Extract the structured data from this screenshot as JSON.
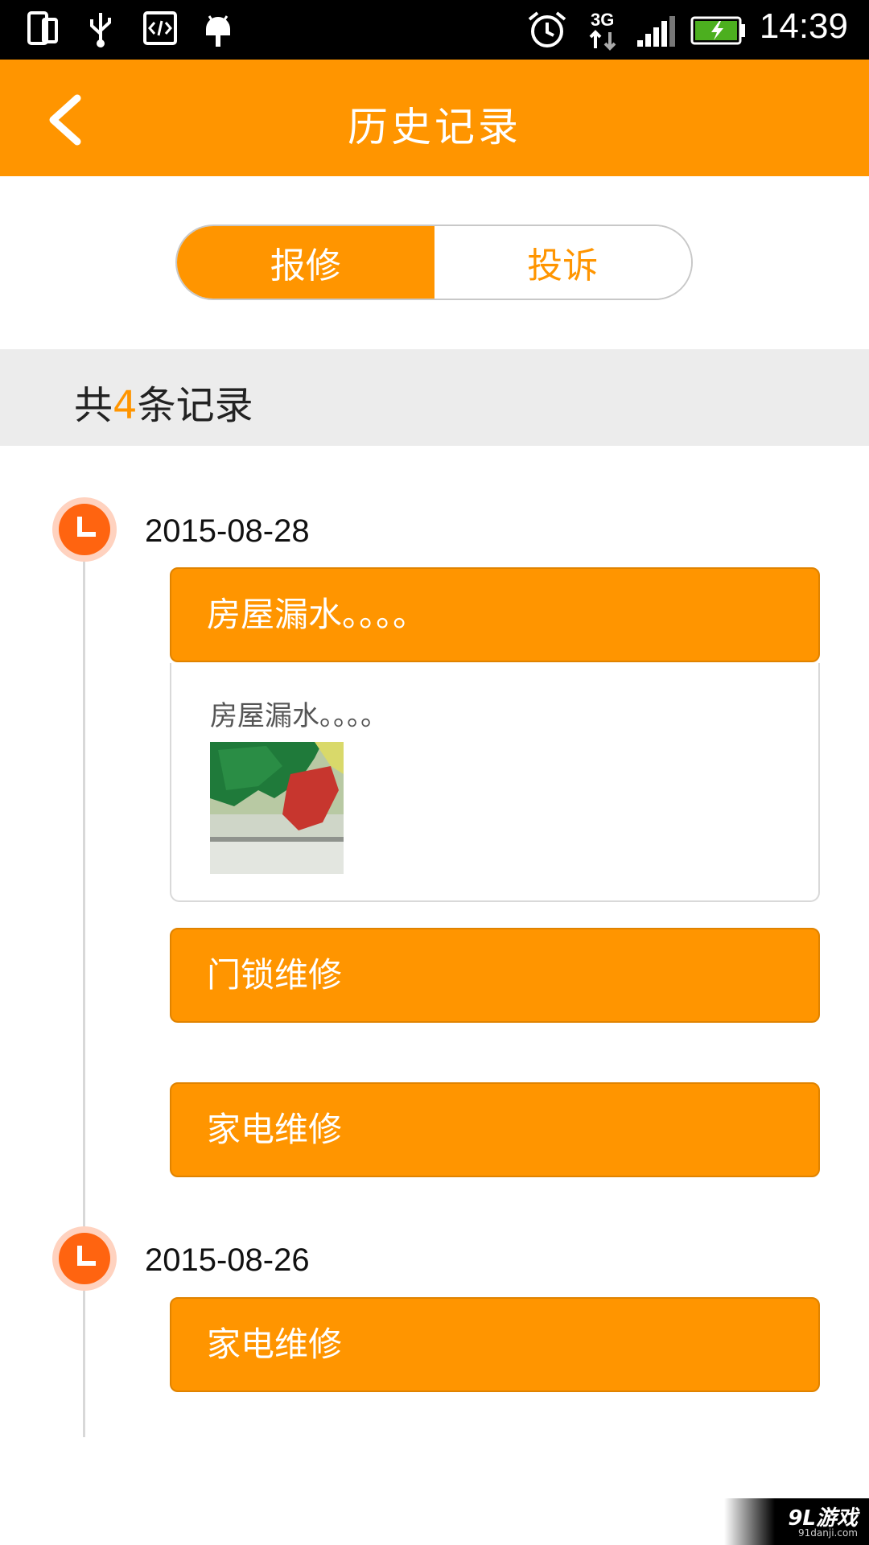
{
  "status_bar": {
    "time": "14:39",
    "network": "3G",
    "icons": [
      "phone-screens-icon",
      "usb-icon",
      "code-icon",
      "android-icon",
      "alarm-icon",
      "network-3g-icon",
      "signal-icon",
      "battery-charging-icon"
    ]
  },
  "header": {
    "title": "历史记录",
    "back_icon": "chevron-left-icon",
    "background": "#ff9500"
  },
  "tabs": [
    {
      "label": "报修",
      "active": true
    },
    {
      "label": "投诉",
      "active": false
    }
  ],
  "summary": {
    "prefix": "共",
    "count": "4",
    "suffix": "条记录"
  },
  "timeline": [
    {
      "date": "2015-08-28",
      "items": [
        {
          "title": "房屋漏水。。。。",
          "expanded": true,
          "detail": "房屋漏水。。。。",
          "has_image": true
        },
        {
          "title": "门锁维修",
          "expanded": false
        },
        {
          "title": "家电维修",
          "expanded": false
        }
      ]
    },
    {
      "date": "2015-08-26",
      "items": [
        {
          "title": "家电维修",
          "expanded": false
        }
      ]
    }
  ],
  "watermark": {
    "text": "9L游戏",
    "sub": "91danji.com"
  },
  "colors": {
    "accent": "#ff9500",
    "clock": "#ff6410",
    "count_bar": "#ececec"
  }
}
